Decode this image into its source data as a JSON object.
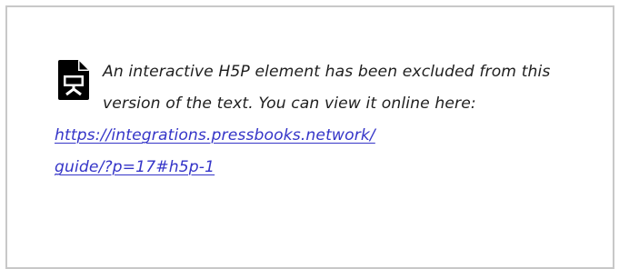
{
  "notice": {
    "icon": "document-presentation-icon",
    "message": "An interactive H5P element has been excluded from this version of the text. You can view it online here:",
    "link_text": "https://integrations.pressbooks.network/guide/?p=17#h5p-1",
    "link_color": "#3535c8"
  }
}
